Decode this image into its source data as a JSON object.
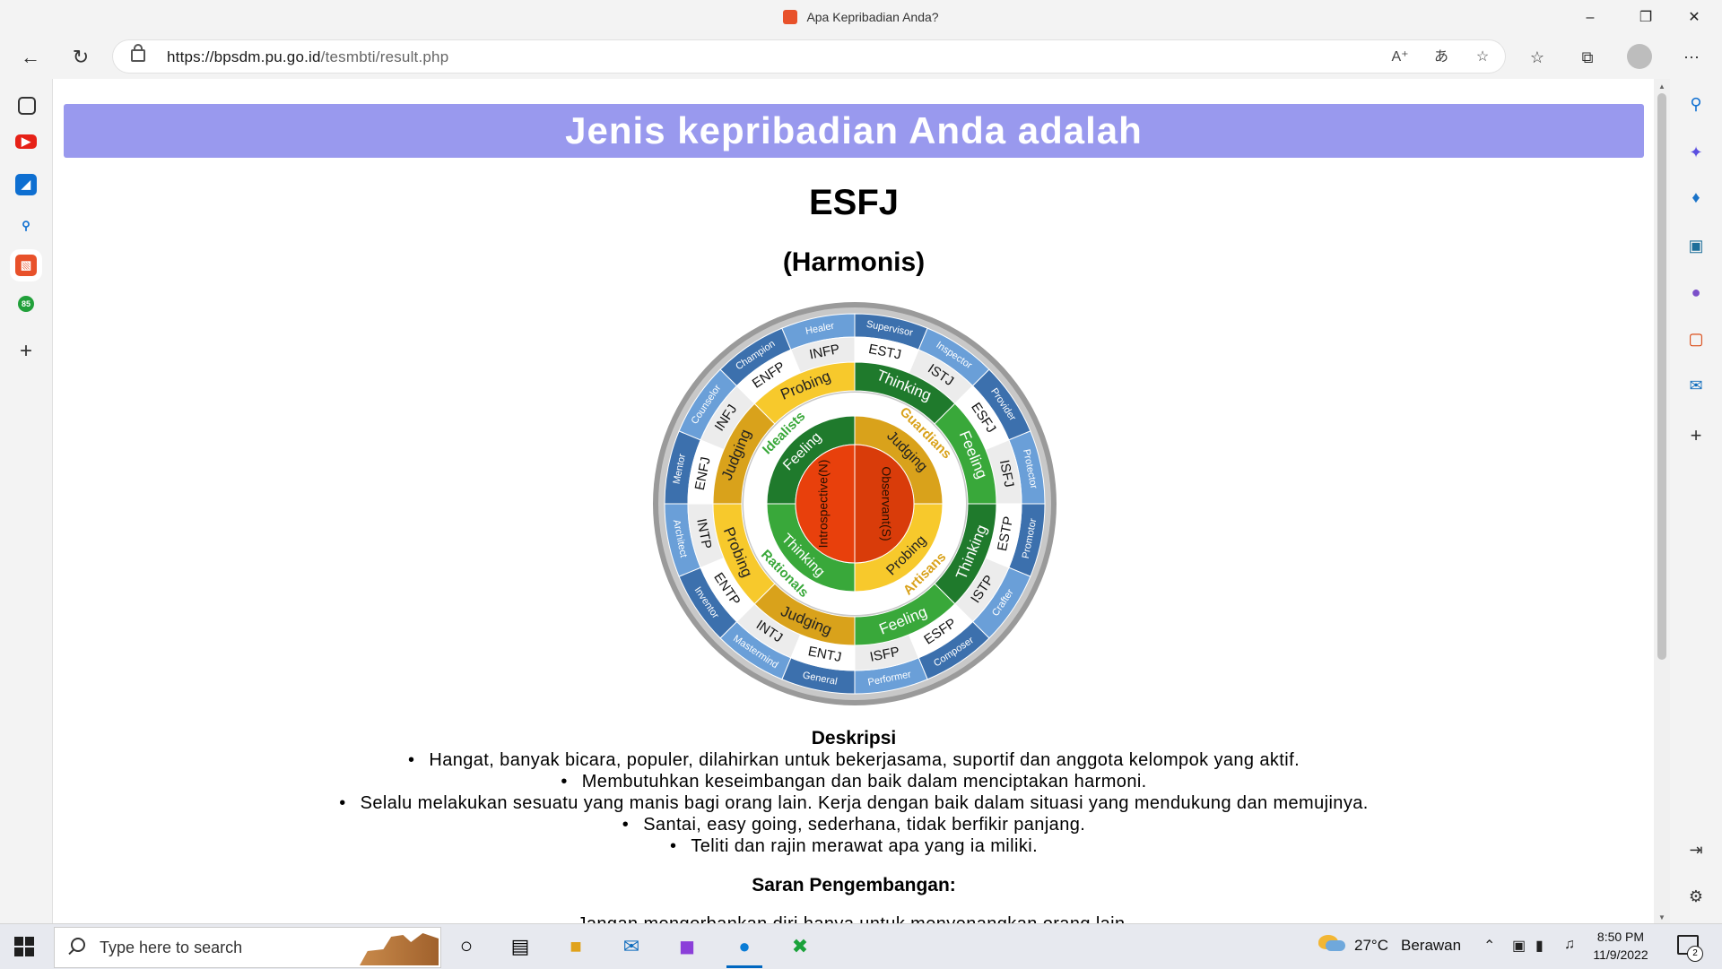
{
  "window": {
    "title": "Apa Kepribadian Anda?"
  },
  "browser": {
    "url_host": "https://bpsdm.pu.go.id",
    "url_path": "/tesmbti/result.php"
  },
  "page": {
    "banner": "Jenis kepribadian Anda adalah",
    "type": "ESFJ",
    "nickname": "(Harmonis)",
    "desc_heading": "Deskripsi",
    "desc_items": [
      "Hangat, banyak bicara, populer, dilahirkan untuk bekerjasama, suportif dan anggota kelompok yang aktif.",
      "Membutuhkan keseimbangan dan baik dalam menciptakan harmoni.",
      "Selalu melakukan sesuatu yang manis bagi orang lain. Kerja dengan baik dalam situasi yang mendukung dan memujinya.",
      "Santai, easy going, sederhana, tidak berfikir panjang.",
      "Teliti dan rajin merawat apa yang ia miliki."
    ],
    "saran_heading": "Saran Pengembangan:",
    "saran_first_item": "Jangan mengorbankan diri hanya untuk menyenangkan orang lain."
  },
  "wheel": {
    "core": [
      "Introspective(N)",
      "Observant(S)"
    ],
    "temperaments": [
      "Idealists",
      "Guardians",
      "Artisans",
      "Rationals"
    ],
    "ring2": [
      "Feeling",
      "Judging",
      "Probing",
      "Thinking"
    ],
    "ring3": [
      "Probing",
      "Thinking",
      "Feeling",
      "Thinking",
      "Feeling",
      "Judging",
      "Probing",
      "Judging"
    ],
    "types": [
      "ESTJ",
      "ISTJ",
      "ESFJ",
      "ISFJ",
      "ESTP",
      "ISTP",
      "ESFP",
      "ISFP",
      "ENTJ",
      "INTJ",
      "ENTP",
      "INTP",
      "ENFJ",
      "INFJ",
      "ENFP",
      "INFP"
    ],
    "roles": [
      "Supervisor",
      "Inspector",
      "Provider",
      "Protector",
      "Promotor",
      "Crafter",
      "Composer",
      "Performer",
      "General",
      "Mastermind",
      "Inventor",
      "Architect",
      "Mentor",
      "Counselor",
      "Champion",
      "Healer"
    ],
    "colors": {
      "orange_core": "#e8400c",
      "dark_green": "#1f7a2c",
      "green": "#39a83a",
      "gold": "#d9a21b",
      "yellow": "#f7c92c",
      "blue_dark": "#3c70ad",
      "blue_light": "#6a9fd8",
      "gray": "#b9b9b9"
    }
  },
  "taskbar": {
    "search_placeholder": "Type here to search",
    "weather_temp": "27°C",
    "weather_desc": "Berawan",
    "time": "8:50 PM",
    "date": "11/9/2022",
    "notif_count": "2"
  }
}
